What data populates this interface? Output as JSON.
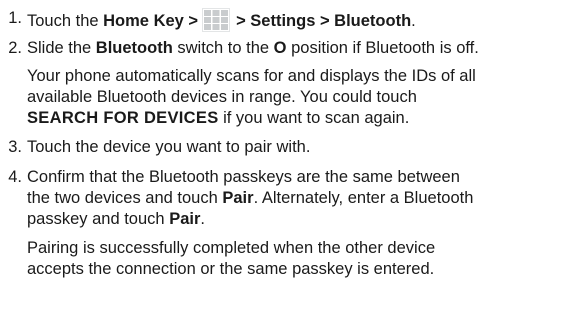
{
  "steps": [
    {
      "number": "1.",
      "parts": [
        {
          "text": "Touch the "
        },
        {
          "text": "Home Key >",
          "bold": true
        },
        {
          "icon": "apps-grid-icon"
        },
        {
          "text": "> Settings > Bluetooth",
          "bold": true
        },
        {
          "text": "."
        }
      ]
    },
    {
      "number": "2.",
      "line1": [
        "Slide the ",
        "Bluetooth",
        " switch to the ",
        "O",
        " position if Bluetooth is off."
      ],
      "para": [
        "Your phone automatically scans for and displays the IDs of all",
        "available Bluetooth devices in range. You could touch",
        [
          "SEARCH FOR DEVICES",
          " if you want to scan again."
        ]
      ]
    },
    {
      "number": "3.",
      "text": "Touch the device you want to pair with."
    },
    {
      "number": "4.",
      "lines": [
        "Confirm that the Bluetooth passkeys are the same between",
        [
          "the two devices and touch ",
          "Pair",
          ". Alternately, enter a Bluetooth"
        ],
        [
          "passkey and touch ",
          "Pair",
          "."
        ]
      ],
      "para": [
        "Pairing is successfully completed when the other device",
        "accepts the connection or the same passkey is entered."
      ]
    }
  ]
}
